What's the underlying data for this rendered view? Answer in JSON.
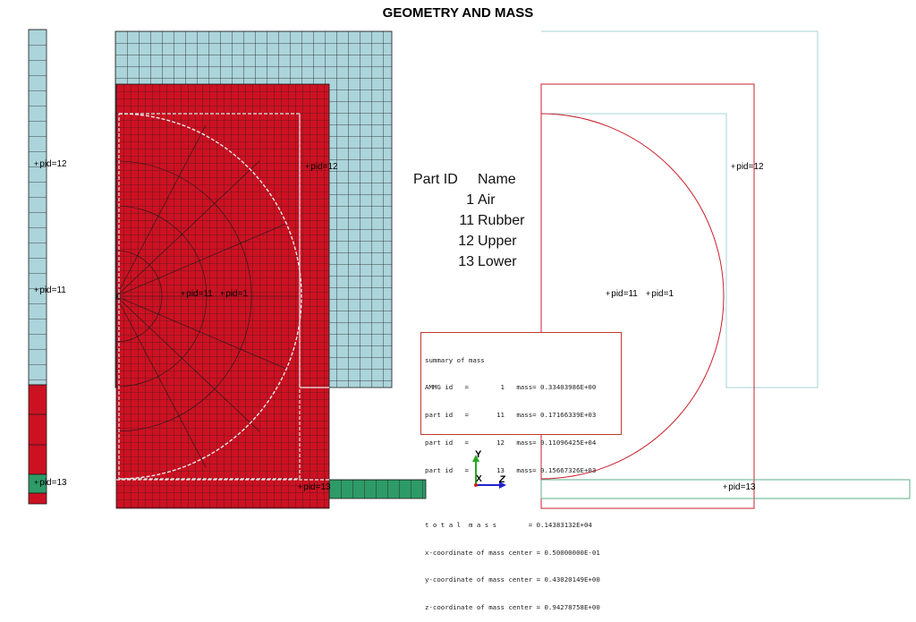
{
  "title": "GEOMETRY AND MASS",
  "colors": {
    "air": "#cc1122",
    "upper": "#acd4db",
    "lower": "#2e9a68",
    "mesh_line": "#1a1a1a",
    "outline_red": "#c8202c",
    "outline_teal": "#a9d3d9",
    "outline_green": "#5fae8a"
  },
  "part_table": {
    "header": {
      "id": "Part ID",
      "name": "Name"
    },
    "rows": [
      {
        "id": "1",
        "name": "Air"
      },
      {
        "id": "11",
        "name": "Rubber"
      },
      {
        "id": "12",
        "name": "Upper"
      },
      {
        "id": "13",
        "name": "Lower"
      }
    ]
  },
  "mass_summary": {
    "lines": [
      "summary of mass",
      "AMMG id   =        1   mass= 0.33403986E+00",
      "part id   =       11   mass= 0.17166339E+03",
      "part id   =       12   mass= 0.11096425E+04",
      "part id   =       13   mass= 0.15667326E+03"
    ],
    "totals": [
      "t o t a l  m a s s        = 0.14383132E+04",
      "x-coordinate of mass center = 0.50000000E-01",
      "y-coordinate of mass center = 0.43020149E+00",
      "z-coordinate of mass center = 0.94278758E+00"
    ]
  },
  "pid_labels": {
    "strip_upper": "pid=12",
    "strip_rubber": "pid=11",
    "strip_lower": "pid=13",
    "mesh_upper": "pid=12",
    "mesh_rubber": "pid=11",
    "mesh_air": "pid=1",
    "mesh_lower": "pid=13",
    "outline_upper": "pid=12",
    "outline_rubber": "pid=11",
    "outline_air": "pid=1",
    "outline_lower": "pid=13"
  },
  "axes": {
    "y": "Y",
    "x": "X",
    "z": "Z"
  }
}
